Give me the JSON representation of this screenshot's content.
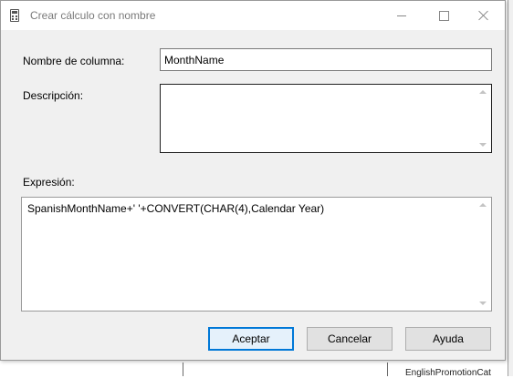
{
  "window": {
    "title": "Crear cálculo con nombre"
  },
  "form": {
    "column_name_label": "Nombre de columna:",
    "column_name_value": "MonthName",
    "description_label": "Descripción:",
    "description_value": "",
    "expression_label": "Expresión:",
    "expression_value": "SpanishMonthName+' '+CONVERT(CHAR(4),Calendar Year)"
  },
  "buttons": {
    "ok": "Aceptar",
    "cancel": "Cancelar",
    "help": "Ayuda"
  },
  "background": {
    "partial_label": "EnglishPromotionCat"
  },
  "icons": {
    "title_icon": "calculator-icon",
    "minimize": "minimize-icon",
    "maximize": "maximize-icon",
    "close": "close-icon"
  },
  "colors": {
    "accent": "#0078d7",
    "dialog_bg": "#f0f0f0"
  }
}
